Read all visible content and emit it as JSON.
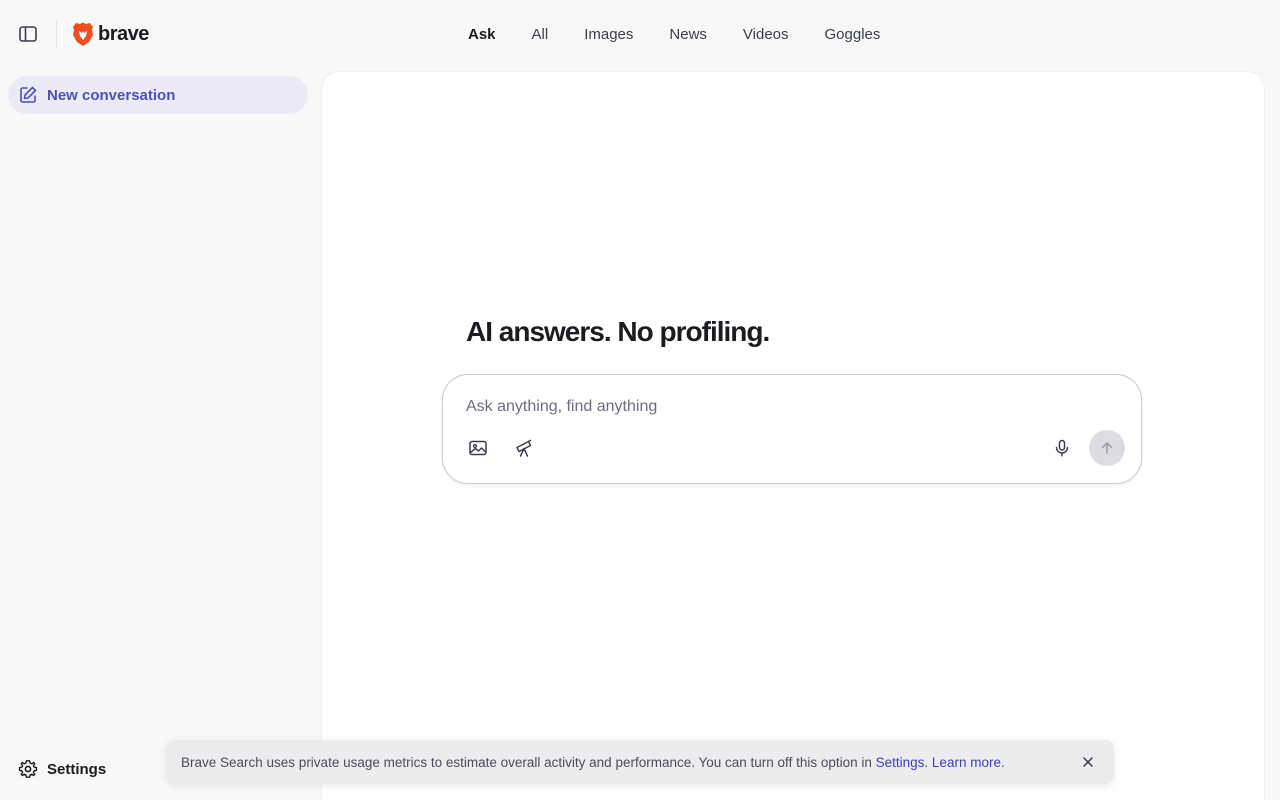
{
  "header": {
    "brand": "brave",
    "tabs": [
      {
        "label": "Ask",
        "active": true
      },
      {
        "label": "All"
      },
      {
        "label": "Images"
      },
      {
        "label": "News"
      },
      {
        "label": "Videos"
      },
      {
        "label": "Goggles"
      }
    ]
  },
  "sidebar": {
    "new_conversation_label": "New conversation",
    "settings_label": "Settings"
  },
  "main": {
    "headline": "AI answers. No profiling.",
    "composer": {
      "placeholder": "Ask anything, find anything",
      "value": ""
    }
  },
  "toast": {
    "text": "Brave Search uses private usage metrics to estimate overall activity and performance. You can turn off this option in ",
    "settings_link": "Settings",
    "separator": ". ",
    "learn_more_link": "Learn more",
    "suffix": "."
  },
  "colors": {
    "accent": "#4e4fbd",
    "brand_orange": "#f04d22",
    "background": "#f8f8f9"
  },
  "icons": {
    "sidebar_toggle": "sidebar-panel-icon",
    "brand": "brave-lion-icon",
    "new_conversation": "edit-pencil-icon",
    "image_upload": "image-icon",
    "research": "telescope-icon",
    "voice": "microphone-icon",
    "send": "arrow-up-icon",
    "settings": "gear-icon",
    "close": "close-icon"
  }
}
